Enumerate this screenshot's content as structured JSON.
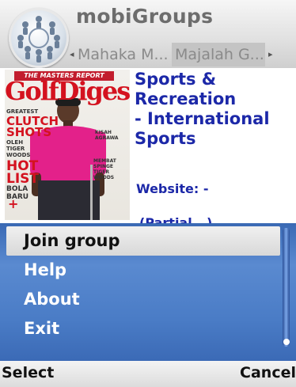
{
  "header": {
    "title": "mobiGroups",
    "logo_icon": "people-circle-logo",
    "tabs": [
      {
        "label": "Mahaka M...",
        "selected": false
      },
      {
        "label": "Majalah G...",
        "selected": true
      }
    ],
    "tab_left_arrow": "◂",
    "tab_right_arrow": "▸"
  },
  "content": {
    "cover": {
      "banner": "THE MASTERS REPORT",
      "masthead": "GolfDigest",
      "line1": "CLUTCH",
      "line2": "SHOTS",
      "line3": "HOT",
      "line4": "LIST",
      "line5": "BOLA",
      "line6": "BARU",
      "line7": "+"
    },
    "category": "Sports &\nRecreation\n- International\nSports",
    "website_label": "Website: -",
    "partial_text": "(Partial...)"
  },
  "menu": {
    "items": [
      {
        "label": "Join group",
        "selected": true
      },
      {
        "label": "Help",
        "selected": false
      },
      {
        "label": "About",
        "selected": false
      },
      {
        "label": "Exit",
        "selected": false
      }
    ]
  },
  "softkeys": {
    "left": "Select",
    "right": "Cancel"
  },
  "colors": {
    "menu_bg": "#4a7cc6",
    "info_text": "#1c28a8",
    "masthead_red": "#d4121f"
  }
}
